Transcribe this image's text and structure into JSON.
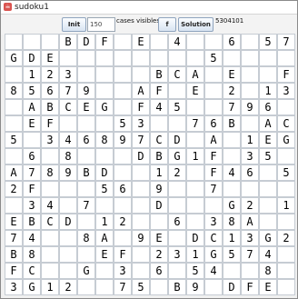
{
  "window": {
    "title": "sudoku1"
  },
  "toolbar": {
    "init_label": "Init",
    "count_value": "150",
    "count_suffix": "cases visibles.",
    "blank_button_label": "f",
    "solution_label": "Solution",
    "seed": "5304101"
  },
  "grid": {
    "rows": [
      [
        "",
        "",
        "",
        "B",
        "D",
        "F",
        "",
        "E",
        "",
        "4",
        "",
        "",
        "6",
        "",
        "5",
        "7"
      ],
      [
        "G",
        "D",
        "E",
        "",
        "",
        "",
        "",
        "",
        "",
        "",
        "",
        "5",
        "",
        "",
        "",
        ""
      ],
      [
        "",
        "1",
        "2",
        "3",
        "",
        "",
        "",
        "",
        "B",
        "C",
        "A",
        "",
        "E",
        "",
        "",
        "F"
      ],
      [
        "8",
        "5",
        "6",
        "7",
        "9",
        "",
        "",
        "A",
        "F",
        "",
        "E",
        "",
        "2",
        "",
        "1",
        "3"
      ],
      [
        "",
        "A",
        "B",
        "C",
        "E",
        "G",
        "",
        "F",
        "4",
        "5",
        "",
        "",
        "7",
        "9",
        "6",
        ""
      ],
      [
        "",
        "E",
        "F",
        "",
        "",
        "",
        "5",
        "3",
        "",
        "",
        "7",
        "6",
        "B",
        "",
        "A",
        "C"
      ],
      [
        "5",
        "",
        "3",
        "4",
        "6",
        "8",
        "9",
        "7",
        "C",
        "D",
        "",
        "A",
        "",
        "1",
        "E",
        "G"
      ],
      [
        "",
        "6",
        "",
        "8",
        "",
        "",
        "",
        "D",
        "B",
        "G",
        "1",
        "F",
        "",
        "3",
        "5",
        ""
      ],
      [
        "A",
        "7",
        "8",
        "9",
        "B",
        "D",
        "",
        "",
        "1",
        "2",
        "",
        "F",
        "4",
        "6",
        "",
        "5"
      ],
      [
        "2",
        "F",
        "",
        "",
        "",
        "5",
        "6",
        "",
        "9",
        "",
        "",
        "7",
        "",
        "",
        "",
        ""
      ],
      [
        "",
        "3",
        "4",
        "",
        "7",
        "",
        "",
        "",
        "D",
        "",
        "",
        "",
        "G",
        "2",
        "",
        "1"
      ],
      [
        "E",
        "B",
        "C",
        "D",
        "",
        "1",
        "2",
        "",
        "",
        "6",
        "",
        "3",
        "8",
        "A",
        "",
        ""
      ],
      [
        "7",
        "4",
        "",
        "",
        "8",
        "A",
        "",
        "9",
        "E",
        "",
        "D",
        "C",
        "1",
        "3",
        "G",
        "2"
      ],
      [
        "B",
        "8",
        "",
        "",
        "",
        "E",
        "F",
        "",
        "2",
        "3",
        "1",
        "G",
        "5",
        "7",
        "4",
        ""
      ],
      [
        "F",
        "C",
        "",
        "",
        "G",
        "",
        "3",
        "",
        "6",
        "",
        "5",
        "4",
        "",
        "",
        "8",
        ""
      ],
      [
        "3",
        "G",
        "1",
        "2",
        "",
        "",
        "7",
        "5",
        "",
        "B",
        "9",
        "",
        "D",
        "F",
        "E",
        ""
      ]
    ]
  }
}
